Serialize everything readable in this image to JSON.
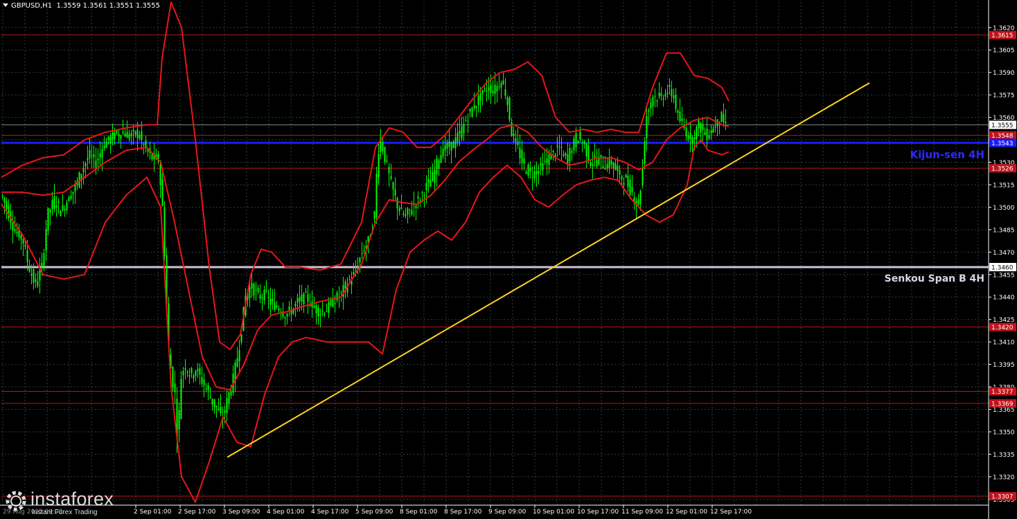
{
  "header": {
    "symbol": "GBPUSD,H1",
    "ohlc": "1.3559 1.3561 1.3551 1.3555"
  },
  "branding": {
    "name": "instaforex",
    "tagline": "Instant Forex Trading"
  },
  "colors": {
    "background": "#000000",
    "grid": "#2f3f3f",
    "candles": "#00ff00",
    "bands": "#e8161b",
    "levels": "#c0121a",
    "kijun": "#1a1aff",
    "senkou": "#cfc3d8",
    "trend": "#ffd21f",
    "axis_text": "#ffffff"
  },
  "chart_data": {
    "type": "candlestick",
    "symbol": "GBPUSD",
    "timeframe": "H1",
    "ylim": [
      1.3301,
      1.3637
    ],
    "y_ticks": [
      "1.3620",
      "1.3605",
      "1.3590",
      "1.3575",
      "1.3560",
      "1.3545",
      "1.3530",
      "1.3515",
      "1.3500",
      "1.3485",
      "1.3470",
      "1.3455",
      "1.3440",
      "1.3425",
      "1.3410",
      "1.3395",
      "1.3380",
      "1.3365",
      "1.3350",
      "1.3335",
      "1.3320",
      "1.3305"
    ],
    "x_ticks": [
      "2 Sep 01:00",
      "2 Sep 17:00",
      "3 Sep 09:00",
      "4 Sep 01:00",
      "4 Sep 17:00",
      "5 Sep 09:00",
      "8 Sep 01:00",
      "8 Sep 17:00",
      "9 Sep 09:00",
      "10 Sep 01:00",
      "10 Sep 17:00",
      "11 Sep 09:00",
      "12 Sep 01:00",
      "12 Sep 17:00"
    ],
    "x_first_label": "29 Aug 2025 09:00",
    "last_price": 1.3555,
    "levels": [
      {
        "price": 1.3615,
        "label": "1.3615"
      },
      {
        "price": 1.3548,
        "label": "1.3548"
      },
      {
        "price": 1.3526,
        "label": "1.3526"
      },
      {
        "price": 1.342,
        "label": "1.3420"
      },
      {
        "price": 1.3377,
        "label": "1.3377"
      },
      {
        "price": 1.3369,
        "label": "1.3369"
      },
      {
        "price": 1.3307,
        "label": "1.3307"
      }
    ],
    "kijun": {
      "price": 1.3543,
      "label": "1.3543",
      "name": "Kijun-sen 4H"
    },
    "senkou": {
      "price": 1.346,
      "label": "1.3460",
      "name": "Senkou Span B 4H"
    },
    "trendline": {
      "from": {
        "x": "3 Sep 09:00",
        "y": 1.3333
      },
      "to": {
        "x": "13 Sep",
        "y": 1.3583
      }
    },
    "price_path": [
      [
        0,
        1.3508
      ],
      [
        10,
        1.3496
      ],
      [
        20,
        1.3483
      ],
      [
        30,
        1.3479
      ],
      [
        38,
        1.3462
      ],
      [
        48,
        1.3448
      ],
      [
        58,
        1.346
      ],
      [
        66,
        1.3495
      ],
      [
        76,
        1.3505
      ],
      [
        86,
        1.3497
      ],
      [
        96,
        1.3506
      ],
      [
        106,
        1.3513
      ],
      [
        116,
        1.3525
      ],
      [
        126,
        1.3535
      ],
      [
        136,
        1.353
      ],
      [
        146,
        1.3541
      ],
      [
        156,
        1.3546
      ],
      [
        166,
        1.3549
      ],
      [
        176,
        1.355
      ],
      [
        186,
        1.3547
      ],
      [
        196,
        1.355
      ],
      [
        206,
        1.354
      ],
      [
        216,
        1.3533
      ],
      [
        226,
        1.3532
      ],
      [
        232,
        1.35
      ],
      [
        236,
        1.346
      ],
      [
        240,
        1.341
      ],
      [
        245,
        1.3388
      ],
      [
        250,
        1.3375
      ],
      [
        254,
        1.334
      ],
      [
        258,
        1.3385
      ],
      [
        264,
        1.3395
      ],
      [
        272,
        1.3388
      ],
      [
        280,
        1.3392
      ],
      [
        288,
        1.3385
      ],
      [
        296,
        1.3378
      ],
      [
        304,
        1.337
      ],
      [
        310,
        1.3366
      ],
      [
        318,
        1.3358
      ],
      [
        326,
        1.3372
      ],
      [
        334,
        1.3385
      ],
      [
        342,
        1.3405
      ],
      [
        352,
        1.344
      ],
      [
        360,
        1.3448
      ],
      [
        370,
        1.344
      ],
      [
        380,
        1.3442
      ],
      [
        390,
        1.3435
      ],
      [
        400,
        1.3433
      ],
      [
        410,
        1.3428
      ],
      [
        420,
        1.3432
      ],
      [
        430,
        1.3438
      ],
      [
        440,
        1.344
      ],
      [
        450,
        1.3433
      ],
      [
        460,
        1.343
      ],
      [
        470,
        1.3432
      ],
      [
        480,
        1.3438
      ],
      [
        490,
        1.3442
      ],
      [
        500,
        1.345
      ],
      [
        510,
        1.3456
      ],
      [
        520,
        1.347
      ],
      [
        530,
        1.3478
      ],
      [
        538,
        1.3495
      ],
      [
        542,
        1.353
      ],
      [
        546,
        1.3548
      ],
      [
        552,
        1.3535
      ],
      [
        562,
        1.3515
      ],
      [
        572,
        1.35
      ],
      [
        582,
        1.3493
      ],
      [
        592,
        1.35
      ],
      [
        602,
        1.3505
      ],
      [
        612,
        1.3513
      ],
      [
        622,
        1.352
      ],
      [
        632,
        1.3535
      ],
      [
        642,
        1.354
      ],
      [
        652,
        1.3542
      ],
      [
        662,
        1.355
      ],
      [
        672,
        1.356
      ],
      [
        682,
        1.3568
      ],
      [
        692,
        1.3575
      ],
      [
        702,
        1.358
      ],
      [
        712,
        1.3578
      ],
      [
        720,
        1.3585
      ],
      [
        728,
        1.3576
      ],
      [
        736,
        1.355
      ],
      [
        744,
        1.354
      ],
      [
        754,
        1.3527
      ],
      [
        764,
        1.3522
      ],
      [
        774,
        1.3525
      ],
      [
        784,
        1.353
      ],
      [
        794,
        1.3535
      ],
      [
        804,
        1.354
      ],
      [
        814,
        1.3532
      ],
      [
        824,
        1.354
      ],
      [
        830,
        1.3548
      ],
      [
        840,
        1.3542
      ],
      [
        850,
        1.353
      ],
      [
        860,
        1.3532
      ],
      [
        870,
        1.3528
      ],
      [
        880,
        1.353
      ],
      [
        890,
        1.3522
      ],
      [
        900,
        1.3518
      ],
      [
        910,
        1.351
      ],
      [
        918,
        1.35
      ],
      [
        924,
        1.352
      ],
      [
        930,
        1.356
      ],
      [
        940,
        1.3575
      ],
      [
        950,
        1.3572
      ],
      [
        960,
        1.3578
      ],
      [
        970,
        1.3575
      ],
      [
        976,
        1.356
      ],
      [
        986,
        1.3552
      ],
      [
        996,
        1.3545
      ],
      [
        1006,
        1.3555
      ],
      [
        1016,
        1.3548
      ],
      [
        1026,
        1.3552
      ],
      [
        1036,
        1.356
      ],
      [
        1046,
        1.3555
      ]
    ],
    "bands": [
      [
        [
          0,
          1.352
        ],
        [
          30,
          1.3528
        ],
        [
          60,
          1.3533
        ],
        [
          90,
          1.3535
        ],
        [
          120,
          1.3545
        ],
        [
          150,
          1.355
        ],
        [
          180,
          1.3553
        ],
        [
          210,
          1.3555
        ],
        [
          225,
          1.3555
        ],
        [
          232,
          1.36
        ],
        [
          245,
          1.3637
        ],
        [
          260,
          1.362
        ],
        [
          280,
          1.3545
        ],
        [
          300,
          1.346
        ],
        [
          315,
          1.341
        ],
        [
          330,
          1.3405
        ],
        [
          345,
          1.3415
        ],
        [
          360,
          1.3455
        ],
        [
          375,
          1.3472
        ],
        [
          390,
          1.347
        ],
        [
          410,
          1.346
        ],
        [
          430,
          1.346
        ],
        [
          460,
          1.3458
        ],
        [
          490,
          1.3462
        ],
        [
          520,
          1.349
        ],
        [
          540,
          1.354
        ],
        [
          560,
          1.3553
        ],
        [
          580,
          1.355
        ],
        [
          600,
          1.354
        ],
        [
          620,
          1.354
        ],
        [
          640,
          1.3548
        ],
        [
          660,
          1.356
        ],
        [
          680,
          1.3572
        ],
        [
          700,
          1.3583
        ],
        [
          720,
          1.359
        ],
        [
          740,
          1.3592
        ],
        [
          760,
          1.3597
        ],
        [
          780,
          1.3588
        ],
        [
          800,
          1.356
        ],
        [
          820,
          1.355
        ],
        [
          840,
          1.3552
        ],
        [
          860,
          1.355
        ],
        [
          880,
          1.3552
        ],
        [
          900,
          1.355
        ],
        [
          920,
          1.355
        ],
        [
          940,
          1.358
        ],
        [
          960,
          1.3603
        ],
        [
          980,
          1.3603
        ],
        [
          1000,
          1.3588
        ],
        [
          1020,
          1.3586
        ],
        [
          1040,
          1.358
        ],
        [
          1050,
          1.3571
        ]
      ],
      [
        [
          0,
          1.351
        ],
        [
          30,
          1.351
        ],
        [
          60,
          1.3508
        ],
        [
          90,
          1.351
        ],
        [
          120,
          1.352
        ],
        [
          150,
          1.353
        ],
        [
          180,
          1.3538
        ],
        [
          210,
          1.354
        ],
        [
          230,
          1.353
        ],
        [
          250,
          1.349
        ],
        [
          270,
          1.3445
        ],
        [
          290,
          1.34
        ],
        [
          310,
          1.338
        ],
        [
          330,
          1.3378
        ],
        [
          350,
          1.3395
        ],
        [
          370,
          1.3418
        ],
        [
          390,
          1.3428
        ],
        [
          410,
          1.343
        ],
        [
          430,
          1.3433
        ],
        [
          460,
          1.3437
        ],
        [
          490,
          1.344
        ],
        [
          520,
          1.3462
        ],
        [
          540,
          1.349
        ],
        [
          560,
          1.3505
        ],
        [
          580,
          1.3503
        ],
        [
          600,
          1.3502
        ],
        [
          620,
          1.3508
        ],
        [
          640,
          1.3518
        ],
        [
          660,
          1.353
        ],
        [
          680,
          1.3538
        ],
        [
          700,
          1.3545
        ],
        [
          720,
          1.3553
        ],
        [
          740,
          1.3555
        ],
        [
          760,
          1.355
        ],
        [
          780,
          1.354
        ],
        [
          800,
          1.3533
        ],
        [
          820,
          1.3528
        ],
        [
          840,
          1.353
        ],
        [
          860,
          1.3533
        ],
        [
          880,
          1.3533
        ],
        [
          900,
          1.353
        ],
        [
          920,
          1.3525
        ],
        [
          940,
          1.353
        ],
        [
          960,
          1.3545
        ],
        [
          980,
          1.3553
        ],
        [
          1000,
          1.3558
        ],
        [
          1020,
          1.356
        ],
        [
          1040,
          1.3555
        ],
        [
          1050,
          1.3554
        ]
      ],
      [
        [
          0,
          1.3502
        ],
        [
          30,
          1.3482
        ],
        [
          60,
          1.3455
        ],
        [
          90,
          1.3452
        ],
        [
          120,
          1.3455
        ],
        [
          150,
          1.349
        ],
        [
          180,
          1.3508
        ],
        [
          210,
          1.352
        ],
        [
          230,
          1.35
        ],
        [
          245,
          1.338
        ],
        [
          260,
          1.332
        ],
        [
          280,
          1.3303
        ],
        [
          300,
          1.333
        ],
        [
          320,
          1.336
        ],
        [
          340,
          1.3343
        ],
        [
          360,
          1.334
        ],
        [
          380,
          1.3375
        ],
        [
          400,
          1.34
        ],
        [
          420,
          1.341
        ],
        [
          440,
          1.3413
        ],
        [
          470,
          1.341
        ],
        [
          500,
          1.341
        ],
        [
          530,
          1.341
        ],
        [
          550,
          1.3402
        ],
        [
          570,
          1.3445
        ],
        [
          590,
          1.347
        ],
        [
          610,
          1.3478
        ],
        [
          630,
          1.3484
        ],
        [
          650,
          1.3478
        ],
        [
          670,
          1.349
        ],
        [
          690,
          1.351
        ],
        [
          710,
          1.352
        ],
        [
          730,
          1.3528
        ],
        [
          750,
          1.352
        ],
        [
          770,
          1.3505
        ],
        [
          790,
          1.35
        ],
        [
          810,
          1.3508
        ],
        [
          830,
          1.3515
        ],
        [
          850,
          1.3518
        ],
        [
          870,
          1.352
        ],
        [
          890,
          1.3518
        ],
        [
          910,
          1.3505
        ],
        [
          930,
          1.3495
        ],
        [
          950,
          1.349
        ],
        [
          970,
          1.3495
        ],
        [
          990,
          1.3515
        ],
        [
          1000,
          1.354
        ],
        [
          1010,
          1.3545
        ],
        [
          1020,
          1.3538
        ],
        [
          1040,
          1.3535
        ],
        [
          1050,
          1.3537
        ]
      ]
    ]
  }
}
